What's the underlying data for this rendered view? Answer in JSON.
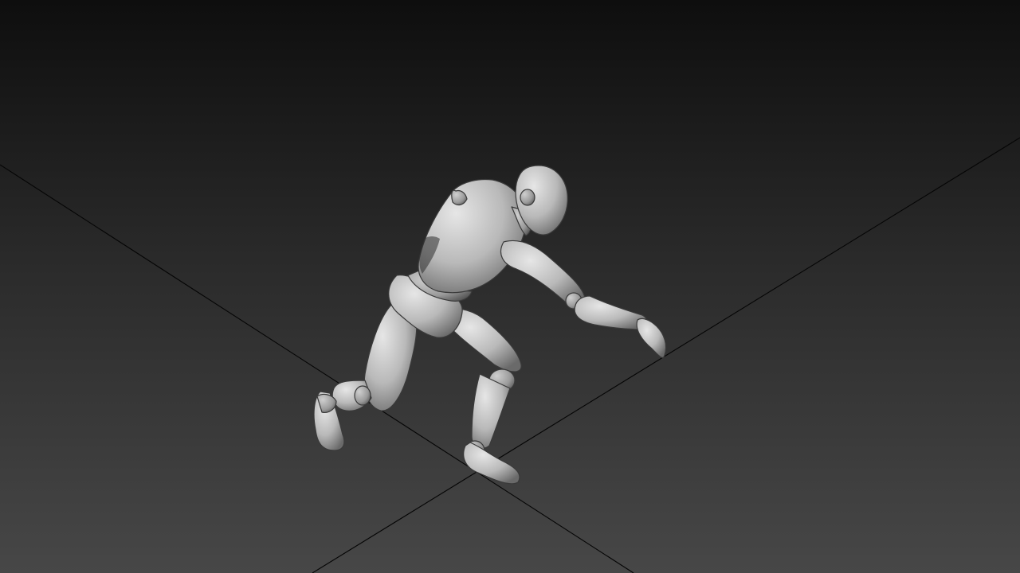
{
  "viewport": {
    "background_top": "#0e0e0e",
    "background_mid": "#2a2a2a",
    "background_bottom": "#474747",
    "grid_line_color": "#050505",
    "mannequin_base": "#b9b9b9",
    "mannequin_highlight": "#e6e6e6",
    "mannequin_shadow": "#4a4a4a"
  },
  "scene": {
    "object": "mannequin-character",
    "grid": "ground-plane-axes"
  }
}
